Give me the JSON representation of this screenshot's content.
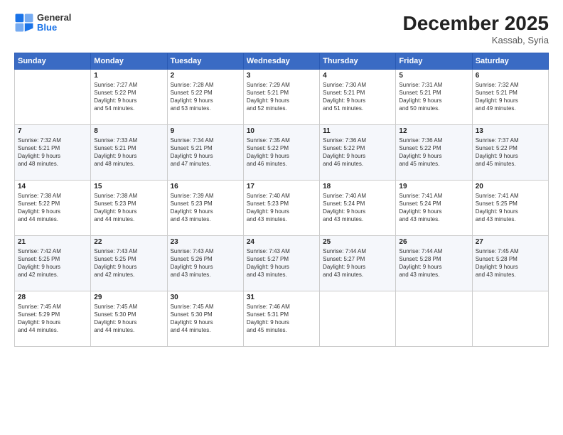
{
  "header": {
    "logo": {
      "general": "General",
      "blue": "Blue"
    },
    "title": "December 2025",
    "location": "Kassab, Syria"
  },
  "days_of_week": [
    "Sunday",
    "Monday",
    "Tuesday",
    "Wednesday",
    "Thursday",
    "Friday",
    "Saturday"
  ],
  "weeks": [
    [
      {
        "day": "",
        "info": ""
      },
      {
        "day": "1",
        "info": "Sunrise: 7:27 AM\nSunset: 5:22 PM\nDaylight: 9 hours\nand 54 minutes."
      },
      {
        "day": "2",
        "info": "Sunrise: 7:28 AM\nSunset: 5:22 PM\nDaylight: 9 hours\nand 53 minutes."
      },
      {
        "day": "3",
        "info": "Sunrise: 7:29 AM\nSunset: 5:21 PM\nDaylight: 9 hours\nand 52 minutes."
      },
      {
        "day": "4",
        "info": "Sunrise: 7:30 AM\nSunset: 5:21 PM\nDaylight: 9 hours\nand 51 minutes."
      },
      {
        "day": "5",
        "info": "Sunrise: 7:31 AM\nSunset: 5:21 PM\nDaylight: 9 hours\nand 50 minutes."
      },
      {
        "day": "6",
        "info": "Sunrise: 7:32 AM\nSunset: 5:21 PM\nDaylight: 9 hours\nand 49 minutes."
      }
    ],
    [
      {
        "day": "7",
        "info": "Sunrise: 7:32 AM\nSunset: 5:21 PM\nDaylight: 9 hours\nand 48 minutes."
      },
      {
        "day": "8",
        "info": "Sunrise: 7:33 AM\nSunset: 5:21 PM\nDaylight: 9 hours\nand 48 minutes."
      },
      {
        "day": "9",
        "info": "Sunrise: 7:34 AM\nSunset: 5:21 PM\nDaylight: 9 hours\nand 47 minutes."
      },
      {
        "day": "10",
        "info": "Sunrise: 7:35 AM\nSunset: 5:22 PM\nDaylight: 9 hours\nand 46 minutes."
      },
      {
        "day": "11",
        "info": "Sunrise: 7:36 AM\nSunset: 5:22 PM\nDaylight: 9 hours\nand 46 minutes."
      },
      {
        "day": "12",
        "info": "Sunrise: 7:36 AM\nSunset: 5:22 PM\nDaylight: 9 hours\nand 45 minutes."
      },
      {
        "day": "13",
        "info": "Sunrise: 7:37 AM\nSunset: 5:22 PM\nDaylight: 9 hours\nand 45 minutes."
      }
    ],
    [
      {
        "day": "14",
        "info": "Sunrise: 7:38 AM\nSunset: 5:22 PM\nDaylight: 9 hours\nand 44 minutes."
      },
      {
        "day": "15",
        "info": "Sunrise: 7:38 AM\nSunset: 5:23 PM\nDaylight: 9 hours\nand 44 minutes."
      },
      {
        "day": "16",
        "info": "Sunrise: 7:39 AM\nSunset: 5:23 PM\nDaylight: 9 hours\nand 43 minutes."
      },
      {
        "day": "17",
        "info": "Sunrise: 7:40 AM\nSunset: 5:23 PM\nDaylight: 9 hours\nand 43 minutes."
      },
      {
        "day": "18",
        "info": "Sunrise: 7:40 AM\nSunset: 5:24 PM\nDaylight: 9 hours\nand 43 minutes."
      },
      {
        "day": "19",
        "info": "Sunrise: 7:41 AM\nSunset: 5:24 PM\nDaylight: 9 hours\nand 43 minutes."
      },
      {
        "day": "20",
        "info": "Sunrise: 7:41 AM\nSunset: 5:25 PM\nDaylight: 9 hours\nand 43 minutes."
      }
    ],
    [
      {
        "day": "21",
        "info": "Sunrise: 7:42 AM\nSunset: 5:25 PM\nDaylight: 9 hours\nand 42 minutes."
      },
      {
        "day": "22",
        "info": "Sunrise: 7:43 AM\nSunset: 5:25 PM\nDaylight: 9 hours\nand 42 minutes."
      },
      {
        "day": "23",
        "info": "Sunrise: 7:43 AM\nSunset: 5:26 PM\nDaylight: 9 hours\nand 43 minutes."
      },
      {
        "day": "24",
        "info": "Sunrise: 7:43 AM\nSunset: 5:27 PM\nDaylight: 9 hours\nand 43 minutes."
      },
      {
        "day": "25",
        "info": "Sunrise: 7:44 AM\nSunset: 5:27 PM\nDaylight: 9 hours\nand 43 minutes."
      },
      {
        "day": "26",
        "info": "Sunrise: 7:44 AM\nSunset: 5:28 PM\nDaylight: 9 hours\nand 43 minutes."
      },
      {
        "day": "27",
        "info": "Sunrise: 7:45 AM\nSunset: 5:28 PM\nDaylight: 9 hours\nand 43 minutes."
      }
    ],
    [
      {
        "day": "28",
        "info": "Sunrise: 7:45 AM\nSunset: 5:29 PM\nDaylight: 9 hours\nand 44 minutes."
      },
      {
        "day": "29",
        "info": "Sunrise: 7:45 AM\nSunset: 5:30 PM\nDaylight: 9 hours\nand 44 minutes."
      },
      {
        "day": "30",
        "info": "Sunrise: 7:45 AM\nSunset: 5:30 PM\nDaylight: 9 hours\nand 44 minutes."
      },
      {
        "day": "31",
        "info": "Sunrise: 7:46 AM\nSunset: 5:31 PM\nDaylight: 9 hours\nand 45 minutes."
      },
      {
        "day": "",
        "info": ""
      },
      {
        "day": "",
        "info": ""
      },
      {
        "day": "",
        "info": ""
      }
    ]
  ]
}
